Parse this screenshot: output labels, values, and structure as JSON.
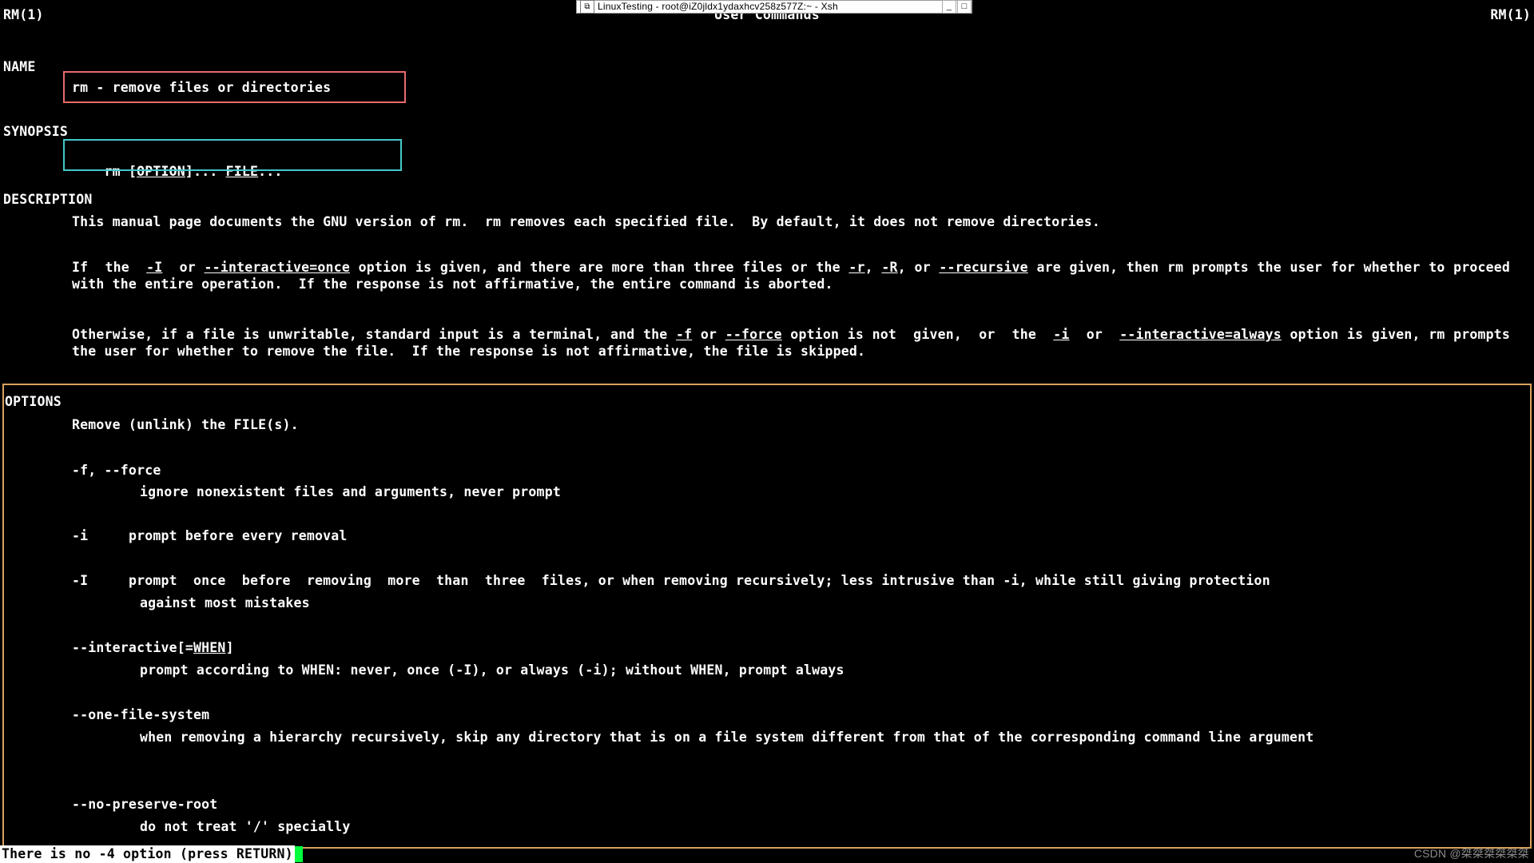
{
  "window": {
    "title": "LinuxTesting - root@iZ0jldx1ydaxhcv258z577Z:~ - Xsh"
  },
  "header": {
    "left": "RM(1)",
    "center": "User Commands",
    "right": "RM(1)"
  },
  "sections": {
    "name": {
      "heading": "NAME",
      "line": "rm - remove files or directories"
    },
    "synopsis": {
      "heading": "SYNOPSIS",
      "parts": [
        "rm",
        "OPTION",
        "...",
        "FILE",
        "..."
      ]
    },
    "description": {
      "heading": "DESCRIPTION",
      "lines": [
        "This manual page documents the GNU version of rm.  rm removes each specified file.  By default, it does not remove directories."
      ],
      "para2": [
        "If  the  ",
        "-I",
        "  or ",
        "--interactive=once",
        " option is given, and there are more than three files or the ",
        "-r",
        ", ",
        "-R",
        ", or ",
        "--recursive",
        " are given, then rm prompts the user for whether to proceed with the entire operation.  If the response is not affirmative, the entire command is aborted."
      ],
      "para3": [
        "Otherwise, if a file is unwritable, standard input is a terminal, and the ",
        "-f",
        " or ",
        "--force",
        " option is not  given,  or  the  ",
        "-i",
        "  or  ",
        "--interactive=always",
        " option is given, rm prompts the user for whether to remove the file.  If the response is not affirmative, the file is skipped."
      ]
    },
    "options": {
      "heading": "OPTIONS",
      "intro": "Remove (unlink) the FILE(s).",
      "items": [
        {
          "flag": "-f, --force",
          "desc": "ignore nonexistent files and arguments, never prompt"
        },
        {
          "flag": "-i",
          "desc": "prompt before every removal"
        },
        {
          "flag": "-I",
          "desc1": "prompt  once  before  removing  more  than  three  files, or when removing recursively; less intrusive than -i, while still giving protection",
          "desc2": "against most mistakes"
        },
        {
          "flag_pre": "--interactive[=",
          "flag_u": "WHEN",
          "flag_post": "]",
          "desc": "prompt according to WHEN: never, once (-I), or always (-i); without WHEN, prompt always"
        },
        {
          "flag": "--one-file-system",
          "desc": "when removing a hierarchy recursively, skip any directory that is on a file system different from that  of  the  corresponding  command  line argument"
        },
        {
          "flag": "--no-preserve-root",
          "desc": "do not treat '/' specially"
        }
      ]
    }
  },
  "status": {
    "message": "There is no -4 option  (press RETURN)"
  },
  "watermark": "CSDN @桀桀桀桀桀桀"
}
